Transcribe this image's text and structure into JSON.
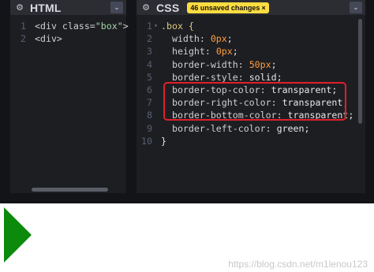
{
  "html_panel": {
    "title": "HTML",
    "gear_icon": "⚙",
    "collapse_icon": "⌄",
    "lines": [
      {
        "n": "1",
        "fold": "",
        "segments": [
          {
            "t": "<div class=",
            "c": "tag"
          },
          {
            "t": "\"box\"",
            "c": "str"
          },
          {
            "t": ">",
            "c": "tag"
          }
        ]
      },
      {
        "n": "2",
        "fold": "",
        "segments": [
          {
            "t": "<div>",
            "c": "tag"
          }
        ]
      }
    ]
  },
  "css_panel": {
    "title": "CSS",
    "badge": "46 unsaved changes",
    "badge_close": "×",
    "gear_icon": "⚙",
    "collapse_icon": "⌄",
    "lines": [
      {
        "n": "1",
        "fold": "▾",
        "segments": [
          {
            "t": ".box {",
            "c": "sel"
          }
        ]
      },
      {
        "n": "2",
        "fold": "",
        "segments": [
          {
            "t": "  width: ",
            "c": "prop"
          },
          {
            "t": "0px",
            "c": "num"
          },
          {
            "t": ";",
            "c": "val"
          }
        ]
      },
      {
        "n": "3",
        "fold": "",
        "segments": [
          {
            "t": "  height: ",
            "c": "prop"
          },
          {
            "t": "0px",
            "c": "num"
          },
          {
            "t": ";",
            "c": "val"
          }
        ]
      },
      {
        "n": "4",
        "fold": "",
        "segments": [
          {
            "t": "  border-width: ",
            "c": "prop"
          },
          {
            "t": "50px",
            "c": "num"
          },
          {
            "t": ";",
            "c": "val"
          }
        ]
      },
      {
        "n": "5",
        "fold": "",
        "segments": [
          {
            "t": "  border-style: ",
            "c": "prop"
          },
          {
            "t": "solid;",
            "c": "val"
          }
        ]
      },
      {
        "n": "6",
        "fold": "",
        "segments": [
          {
            "t": "  border-top-color: ",
            "c": "prop"
          },
          {
            "t": "transparent;",
            "c": "val"
          }
        ]
      },
      {
        "n": "7",
        "fold": "",
        "segments": [
          {
            "t": "  border-right-color: ",
            "c": "prop"
          },
          {
            "t": "transparent;",
            "c": "val"
          }
        ]
      },
      {
        "n": "8",
        "fold": "",
        "segments": [
          {
            "t": "  border-bottom-color: ",
            "c": "prop"
          },
          {
            "t": "transparent;",
            "c": "val"
          }
        ]
      },
      {
        "n": "9",
        "fold": "",
        "segments": [
          {
            "t": "  border-left-color: ",
            "c": "prop"
          },
          {
            "t": "green;",
            "c": "val"
          }
        ]
      },
      {
        "n": "10",
        "fold": "",
        "segments": [
          {
            "t": "}",
            "c": "val"
          }
        ]
      }
    ]
  },
  "output": {
    "shape_color": "#0b8a0b",
    "watermark": "https://blog.csdn.net/m1lenou123"
  },
  "colors": {
    "highlight_box": "#e0202a",
    "badge_bg": "#ffdd40"
  }
}
